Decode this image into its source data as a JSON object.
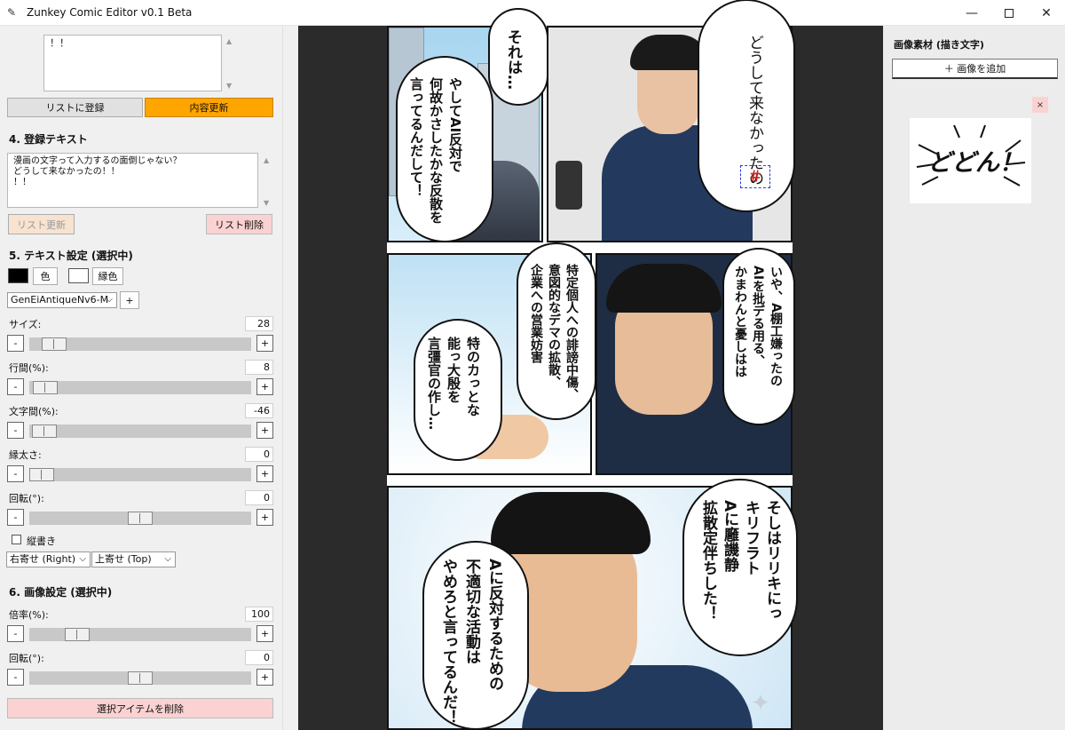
{
  "window": {
    "title": "Zunkey Comic Editor v0.1 Beta",
    "minimize_glyph": "—",
    "close_glyph": "✕"
  },
  "left_panel": {
    "top_text_preview": "！！",
    "register_list_button": "リストに登録",
    "update_content_button": "内容更新",
    "section4": {
      "title": "4. 登録テキスト",
      "text_lines": "漫画の文字って入力するの面倒じゃない？\nどうして来なかったの！！\n！！",
      "update_list_button": "リスト更新",
      "delete_list_button": "リスト削除"
    },
    "section5": {
      "title": "5. テキスト設定 (選択中)",
      "text_color": "#000000",
      "color_button": "色",
      "outline_color": "#ffffff",
      "outline_color_button": "縁色",
      "font": "GenEiAntiqueNv6-M",
      "font_add_button": "+",
      "sliders": [
        {
          "label": "サイズ:",
          "value": "28",
          "minus": "-",
          "plus": "+"
        },
        {
          "label": "行間(%):",
          "value": "8",
          "minus": "-",
          "plus": "+"
        },
        {
          "label": "文字間(%):",
          "value": "-46",
          "minus": "-",
          "plus": "+"
        },
        {
          "label": "縁太さ:",
          "value": "0",
          "minus": "-",
          "plus": "+"
        },
        {
          "label": "回転(°):",
          "value": "0",
          "minus": "-",
          "plus": "+"
        }
      ],
      "vertical_checkbox_label": "縦書き",
      "vertical_checked": false,
      "align_h": "右寄せ (Right)",
      "align_v": "上寄せ (Top)"
    },
    "section6": {
      "title": "6. 画像設定 (選択中)",
      "sliders": [
        {
          "label": "倍率(%):",
          "value": "100",
          "minus": "-",
          "plus": "+"
        },
        {
          "label": "回転(°):",
          "value": "0",
          "minus": "-",
          "plus": "+"
        }
      ],
      "delete_selected_button": "選択アイテムを削除"
    }
  },
  "canvas": {
    "bubbles": {
      "p1_left": "それは…",
      "p1_left2": "やしてAI反対で\n何故かさしたかな反散を\n言ってるんだして！",
      "p1_right": "どうして来なかったの",
      "p1_cursor": "＃",
      "p2_left": "特定個人への誹謗中傷、\n意図的なデマの拡散、\n企業への営業妨害",
      "p2_left2": "特のカっとな\n能っ大殷を\n言彊官の作し…",
      "p2_right": "いや、A棚工嫌ったの\nAIを批デる用る、\nかまわんと憂しはは",
      "p3_right": "そしはリリキにっ\nキリフラト\nAに廱譏静\n拡散定伴ちした！",
      "p3_left": "Aに反対するための\n不適切な活動は\nやめろと言ってるんだ！"
    }
  },
  "right_panel": {
    "heading": "画像素材 (描き文字)",
    "add_image_button": "＋ 画像を追加",
    "asset_close": "×",
    "asset_text": "どどん！"
  },
  "colors": {
    "accent_orange": "#ffa500",
    "delete_pink": "#fbd2d2",
    "canvas_bg": "#2b2b2b"
  }
}
